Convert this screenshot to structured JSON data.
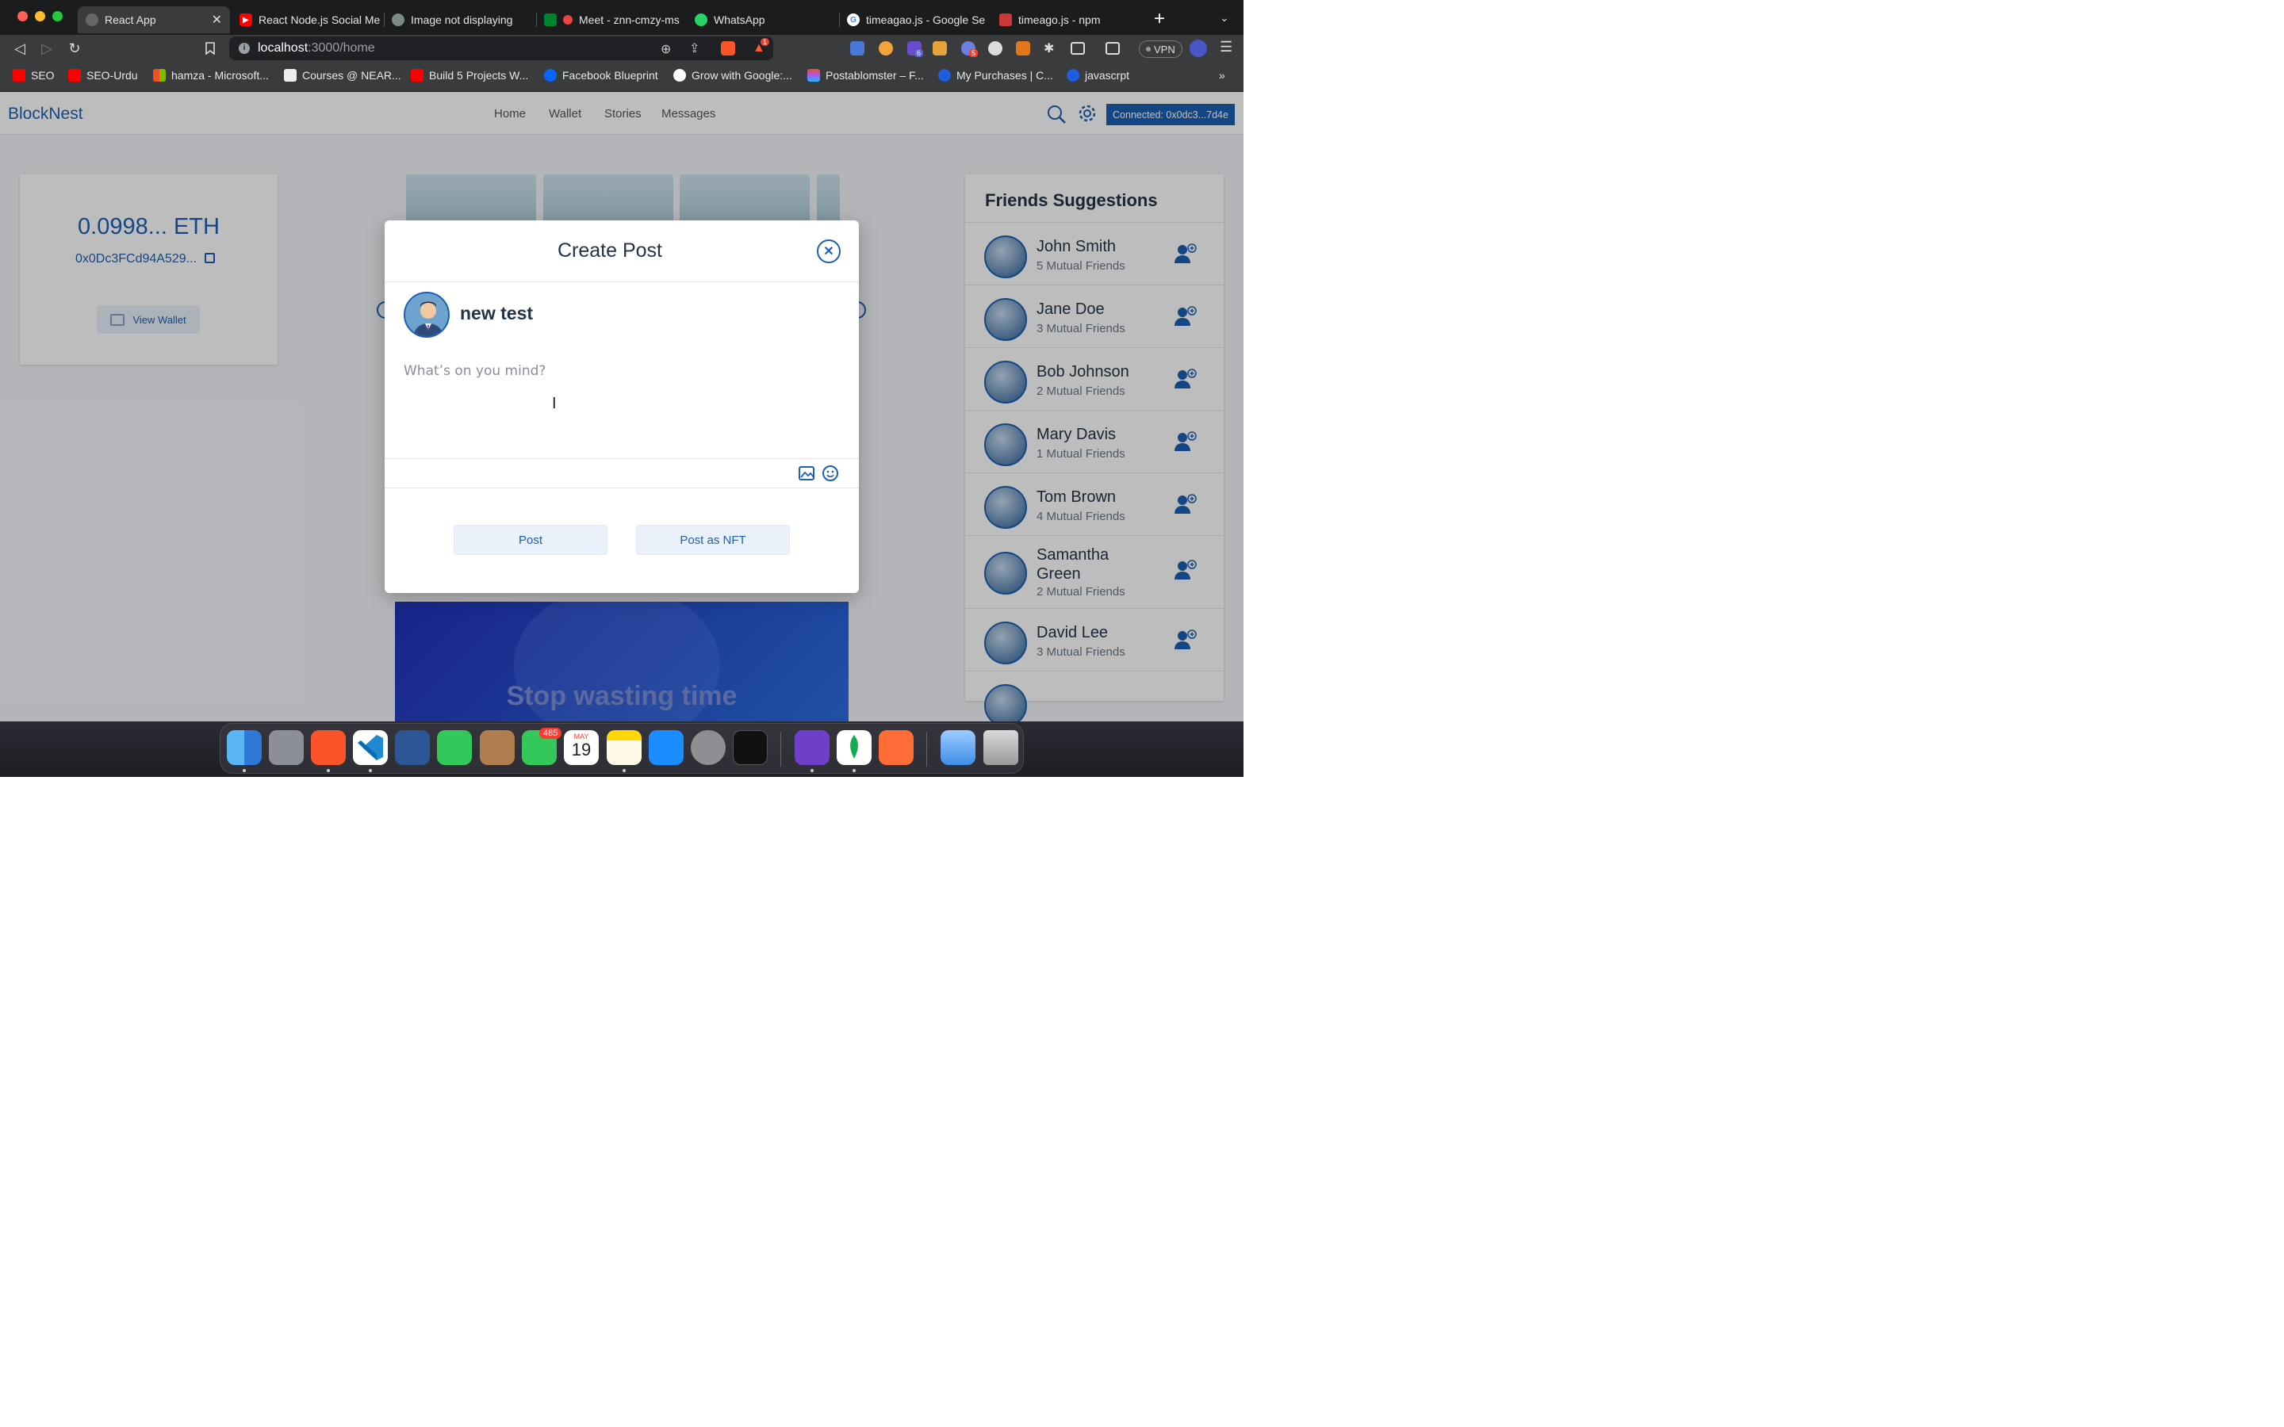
{
  "browser": {
    "tabs": [
      {
        "label": "React App",
        "active": true
      },
      {
        "label": "React Node.js Social Me"
      },
      {
        "label": "Image not displaying"
      },
      {
        "label": "Meet - znn-cmzy-ms"
      },
      {
        "label": "WhatsApp"
      },
      {
        "label": "timeagao.js - Google Se"
      },
      {
        "label": "timeago.js - npm"
      }
    ],
    "url_host": "localhost",
    "url_path": ":3000/home",
    "vpn_label": "VPN",
    "badges": {
      "brave_alert": "1",
      "ext_a": "6",
      "ext_b": "5"
    },
    "bookmarks": [
      {
        "label": "SEO"
      },
      {
        "label": "SEO-Urdu"
      },
      {
        "label": "hamza - Microsoft..."
      },
      {
        "label": "Courses @ NEAR..."
      },
      {
        "label": "Build 5 Projects W..."
      },
      {
        "label": "Facebook Blueprint"
      },
      {
        "label": "Grow with Google:..."
      },
      {
        "label": "Postablomster – F..."
      },
      {
        "label": "My Purchases | C..."
      },
      {
        "label": "javascrpt"
      }
    ],
    "bookmarks_more": "»"
  },
  "app": {
    "logo": "BlockNest",
    "nav": {
      "home": "Home",
      "wallet": "Wallet",
      "stories": "Stories",
      "messages": "Messages"
    },
    "connected": "Connected: 0x0dc3...7d4e",
    "wallet": {
      "balance": "0.0998... ETH",
      "address": "0x0Dc3FCd94A529...",
      "view_button": "View Wallet"
    },
    "friends": {
      "title": "Friends Suggestions",
      "items": [
        {
          "name": "John Smith",
          "mutual": "5 Mutual Friends"
        },
        {
          "name": "Jane Doe",
          "mutual": "3 Mutual Friends"
        },
        {
          "name": "Bob Johnson",
          "mutual": "2 Mutual Friends"
        },
        {
          "name": "Mary Davis",
          "mutual": "1 Mutual Friends"
        },
        {
          "name": "Tom Brown",
          "mutual": "4 Mutual Friends"
        },
        {
          "name": "Samantha Green",
          "mutual": "2 Mutual Friends"
        },
        {
          "name": "David Lee",
          "mutual": "3 Mutual Friends"
        }
      ]
    },
    "banner_text": "Stop wasting time"
  },
  "modal": {
    "title": "Create Post",
    "username": "new test",
    "placeholder": "What’s on you mind?",
    "post_button": "Post",
    "nft_button": "Post as NFT"
  },
  "dock": {
    "messages_badge": "485",
    "calendar_month": "MAY",
    "calendar_day": "19"
  },
  "colors": {
    "accent": "#1d5fb3",
    "heading": "#243447"
  }
}
